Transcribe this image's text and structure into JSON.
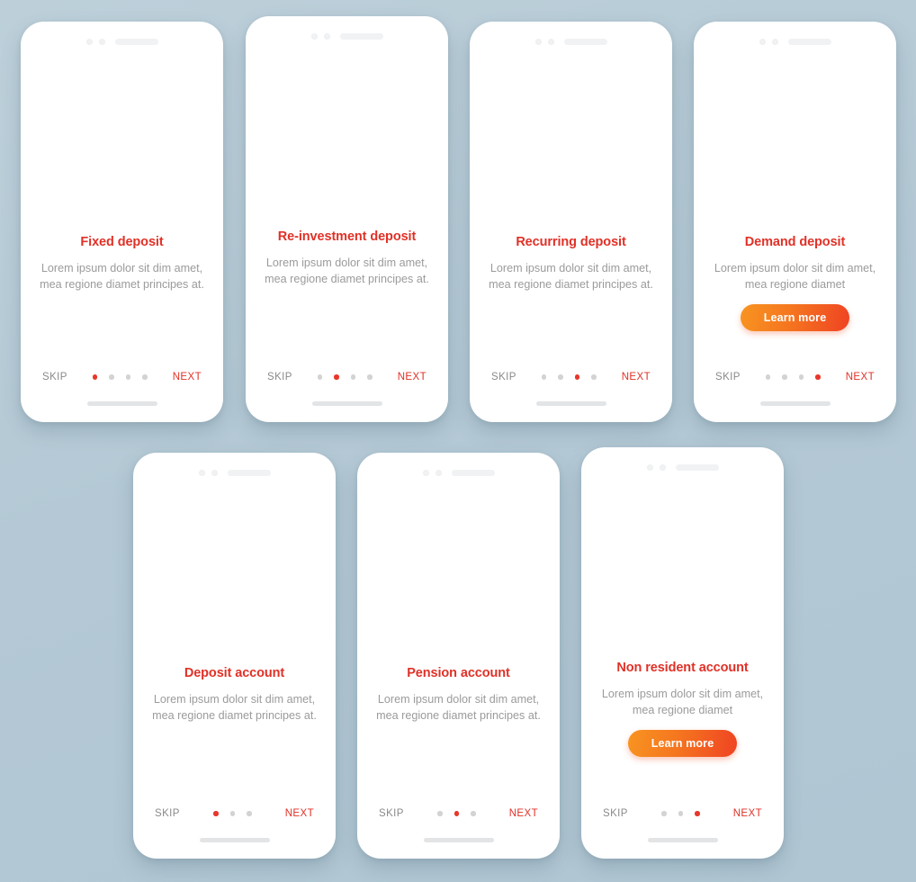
{
  "page": {
    "background_color": "#b7cbd6",
    "accent_title_color": "#e03127",
    "button_gradient_from": "#f89421",
    "button_gradient_to": "#ef4323",
    "body_text_color": "#9b9b9b"
  },
  "cards": [
    {
      "icon": "fixed-deposit-illustration",
      "title": "Fixed deposit",
      "description": "Lorem ipsum dolor sit dim amet, mea regione diamet principes at.",
      "skip_label": "SKIP",
      "next_label": "NEXT",
      "dot_count": 4,
      "active_dot": 0,
      "learn_more": null
    },
    {
      "icon": "re-investment-deposit-illustration",
      "title": "Re-investment deposit",
      "description": "Lorem ipsum dolor sit dim amet, mea regione diamet principes at.",
      "skip_label": "SKIP",
      "next_label": "NEXT",
      "dot_count": 4,
      "active_dot": 1,
      "learn_more": null
    },
    {
      "icon": "recurring-deposit-illustration",
      "title": "Recurring deposit",
      "description": "Lorem ipsum dolor sit dim amet, mea regione diamet principes at.",
      "skip_label": "SKIP",
      "next_label": "NEXT",
      "dot_count": 4,
      "active_dot": 2,
      "learn_more": null
    },
    {
      "icon": "demand-deposit-illustration",
      "title": "Demand deposit",
      "description": "Lorem ipsum dolor sit dim amet, mea regione diamet",
      "skip_label": "SKIP",
      "next_label": "NEXT",
      "dot_count": 4,
      "active_dot": 3,
      "learn_more": "Learn more"
    },
    {
      "icon": "deposit-account-illustration",
      "title": "Deposit account",
      "description": "Lorem ipsum dolor sit dim amet, mea regione diamet principes at.",
      "skip_label": "SKIP",
      "next_label": "NEXT",
      "dot_count": 3,
      "active_dot": 0,
      "learn_more": null
    },
    {
      "icon": "pension-account-illustration",
      "title": "Pension account",
      "description": "Lorem ipsum dolor sit dim amet, mea regione diamet principes at.",
      "skip_label": "SKIP",
      "next_label": "NEXT",
      "dot_count": 3,
      "active_dot": 1,
      "learn_more": null
    },
    {
      "icon": "non-resident-account-illustration",
      "title": "Non resident account",
      "description": "Lorem ipsum dolor sit dim amet, mea regione diamet",
      "skip_label": "SKIP",
      "next_label": "NEXT",
      "dot_count": 3,
      "active_dot": 2,
      "learn_more": "Learn more"
    }
  ]
}
